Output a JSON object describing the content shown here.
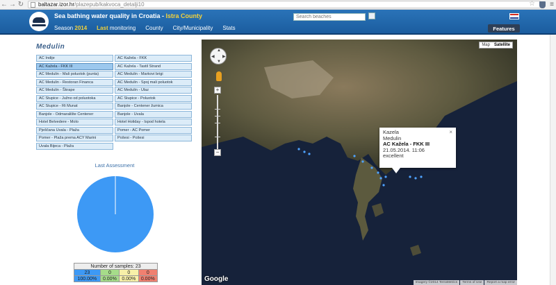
{
  "browser": {
    "url_host": "baltazar.izor.hr",
    "url_path": "/plazepub/kakvoca_detalji10"
  },
  "header": {
    "title_main": "Sea bathing water quality in Croatia - ",
    "title_county": "Istra County",
    "search_placeholder": "Search beaches",
    "features_label": "Features",
    "nav": [
      {
        "label": "Season",
        "value": "2014"
      },
      {
        "label": "Last",
        "value": "monitoring"
      },
      {
        "label": "County"
      },
      {
        "label": "City/Municipality"
      },
      {
        "label": "Stats"
      }
    ]
  },
  "section_title": "Medulin",
  "beaches": [
    "AC Indije",
    "AC Kažela - FKK",
    "AC Kažela - FKK III",
    "AC Kažela - Tastil Strand",
    "AC Medulin - Mali poluotok (punta)",
    "AC Medulin - Markovi brigi",
    "AC Medulin - Restoran Financa",
    "AC Medulin - Spoj mali poluotok",
    "AC Medulin - Škrape",
    "AC Medulin - Ulaz",
    "AC Stupice - Južno od poluotoka",
    "AC Stupice - Poluotok",
    "AC Stupice - Rt Munat",
    "Banjole - Centener žumica",
    "Banjole - Odmaralište Centener",
    "Banjole - Uvala",
    "Hotel Belvedere - Molo",
    "Hotel Holiday - Ispod hotela",
    "Pješčana Uvala - Plaža",
    "Pomer - AC Pomer",
    "Pomer - Plaža prema ACY Marini",
    "Pošesi - Pošesi",
    "Uvala Bijeca - Plaža"
  ],
  "selected_beach": "AC Kažela - FKK III",
  "assessment": {
    "title": "Last Assessment",
    "samples_label": "Number of samples: 23",
    "counts": [
      "23",
      "0",
      "0",
      "0"
    ],
    "percents": [
      "100.00%",
      "0.00%",
      "0.00%",
      "0.00%"
    ],
    "colors": [
      "#3d99f5",
      "#a6dc8a",
      "#f7f0a8",
      "#f08070"
    ],
    "slice_color": "#3d99f5"
  },
  "map": {
    "type_map": "Map",
    "type_satellite": "Satellite",
    "popup": {
      "line1": "Kazela",
      "line2": "Medulin",
      "line3": "AC Kažela - FKK III",
      "line4": "21.05.2014. 11:06",
      "line5": "excellent"
    },
    "attribution": [
      "Imagery ©2014 TerraMetrics",
      "Terms of Use",
      "Report a map error"
    ],
    "google_label": "Google"
  }
}
